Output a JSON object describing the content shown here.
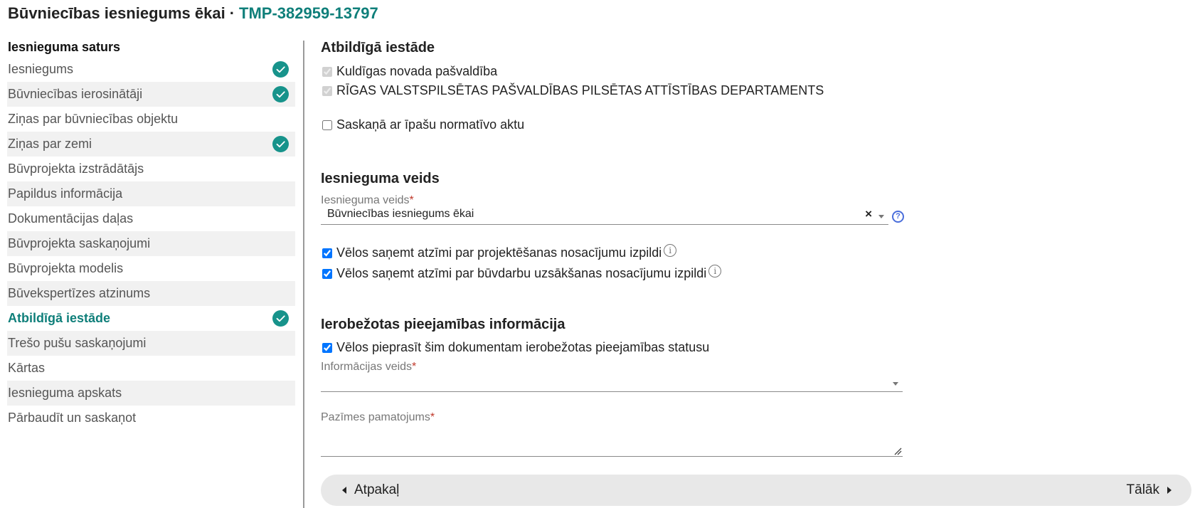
{
  "header": {
    "title": "Būvniecības iesniegums ēkai",
    "separator": "·",
    "reference": "TMP-382959-13797"
  },
  "sidebar": {
    "title": "Iesnieguma saturs",
    "items": [
      {
        "label": "Iesniegums",
        "completed": true
      },
      {
        "label": "Būvniecības ierosinātāji",
        "completed": true
      },
      {
        "label": "Ziņas par būvniecības objektu",
        "completed": false
      },
      {
        "label": "Ziņas par zemi",
        "completed": true
      },
      {
        "label": "Būvprojekta izstrādātājs",
        "completed": false
      },
      {
        "label": "Papildus informācija",
        "completed": false
      },
      {
        "label": "Dokumentācijas daļas",
        "completed": false
      },
      {
        "label": "Būvprojekta saskaņojumi",
        "completed": false
      },
      {
        "label": "Būvprojekta modelis",
        "completed": false
      },
      {
        "label": "Būvekspertīzes atzinums",
        "completed": false
      },
      {
        "label": "Atbildīgā iestāde",
        "completed": true,
        "active": true
      },
      {
        "label": "Trešo pušu saskaņojumi",
        "completed": false
      },
      {
        "label": "Kārtas",
        "completed": false
      },
      {
        "label": "Iesnieguma apskats",
        "completed": false
      },
      {
        "label": "Pārbaudīt un saskaņot",
        "completed": false
      }
    ],
    "accent_color": "#0f7f7a",
    "check_color": "#17938b"
  },
  "responsible_authority": {
    "title": "Atbildīgā iestāde",
    "options": [
      {
        "label": "Kuldīgas novada pašvaldība",
        "checked": true,
        "disabled": true
      },
      {
        "label": "RĪGAS VALSTSPILSĒTAS PAŠVALDĪBAS PILSĒTAS ATTĪSTĪBAS DEPARTAMENTS",
        "checked": true,
        "disabled": true
      }
    ],
    "special_act_label": "Saskaņā ar īpašu normatīvo aktu",
    "special_act_checked": false
  },
  "submission_type": {
    "title": "Iesnieguma veids",
    "field_label": "Iesnieguma veids",
    "required_mark": "*",
    "value": "Būvniecības iesniegums ēkai",
    "clear_symbol": "×",
    "help_symbol": "?",
    "options": [
      {
        "label": "Vēlos saņemt atzīmi par projektēšanas nosacījumu izpildi",
        "checked": true
      },
      {
        "label": "Vēlos saņemt atzīmi par būvdarbu uzsākšanas nosacījumu izpildi",
        "checked": true
      }
    ],
    "info_symbol": "i"
  },
  "restricted_info": {
    "title": "Ierobežotas pieejamības informācija",
    "request_label": "Vēlos pieprasīt šim dokumentam ierobežotas pieejamības statusu",
    "request_checked": true,
    "info_type_label": "Informācijas veids",
    "info_type_value": "",
    "justification_label": "Pazīmes pamatojums",
    "required_mark": "*"
  },
  "navigation": {
    "back_label": "Atpakaļ",
    "next_label": "Tālāk"
  }
}
